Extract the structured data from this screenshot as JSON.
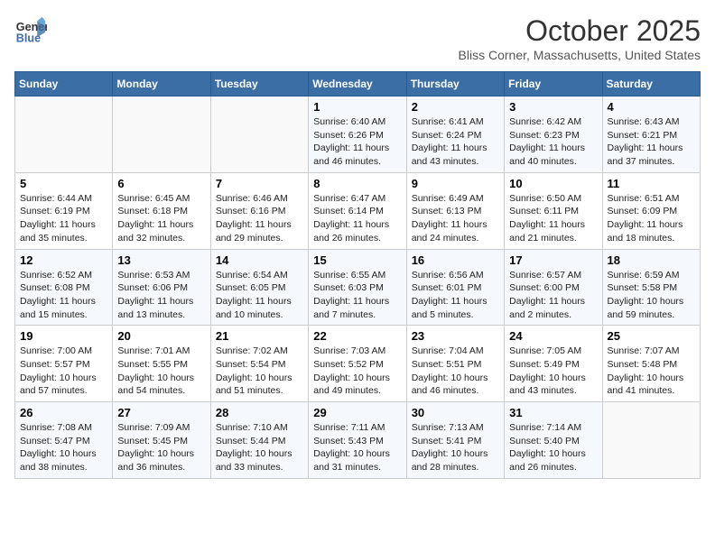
{
  "header": {
    "logo_line1": "General",
    "logo_line2": "Blue",
    "month": "October 2025",
    "location": "Bliss Corner, Massachusetts, United States"
  },
  "days_of_week": [
    "Sunday",
    "Monday",
    "Tuesday",
    "Wednesday",
    "Thursday",
    "Friday",
    "Saturday"
  ],
  "weeks": [
    [
      {
        "num": "",
        "info": ""
      },
      {
        "num": "",
        "info": ""
      },
      {
        "num": "",
        "info": ""
      },
      {
        "num": "1",
        "info": "Sunrise: 6:40 AM\nSunset: 6:26 PM\nDaylight: 11 hours and 46 minutes."
      },
      {
        "num": "2",
        "info": "Sunrise: 6:41 AM\nSunset: 6:24 PM\nDaylight: 11 hours and 43 minutes."
      },
      {
        "num": "3",
        "info": "Sunrise: 6:42 AM\nSunset: 6:23 PM\nDaylight: 11 hours and 40 minutes."
      },
      {
        "num": "4",
        "info": "Sunrise: 6:43 AM\nSunset: 6:21 PM\nDaylight: 11 hours and 37 minutes."
      }
    ],
    [
      {
        "num": "5",
        "info": "Sunrise: 6:44 AM\nSunset: 6:19 PM\nDaylight: 11 hours and 35 minutes."
      },
      {
        "num": "6",
        "info": "Sunrise: 6:45 AM\nSunset: 6:18 PM\nDaylight: 11 hours and 32 minutes."
      },
      {
        "num": "7",
        "info": "Sunrise: 6:46 AM\nSunset: 6:16 PM\nDaylight: 11 hours and 29 minutes."
      },
      {
        "num": "8",
        "info": "Sunrise: 6:47 AM\nSunset: 6:14 PM\nDaylight: 11 hours and 26 minutes."
      },
      {
        "num": "9",
        "info": "Sunrise: 6:49 AM\nSunset: 6:13 PM\nDaylight: 11 hours and 24 minutes."
      },
      {
        "num": "10",
        "info": "Sunrise: 6:50 AM\nSunset: 6:11 PM\nDaylight: 11 hours and 21 minutes."
      },
      {
        "num": "11",
        "info": "Sunrise: 6:51 AM\nSunset: 6:09 PM\nDaylight: 11 hours and 18 minutes."
      }
    ],
    [
      {
        "num": "12",
        "info": "Sunrise: 6:52 AM\nSunset: 6:08 PM\nDaylight: 11 hours and 15 minutes."
      },
      {
        "num": "13",
        "info": "Sunrise: 6:53 AM\nSunset: 6:06 PM\nDaylight: 11 hours and 13 minutes."
      },
      {
        "num": "14",
        "info": "Sunrise: 6:54 AM\nSunset: 6:05 PM\nDaylight: 11 hours and 10 minutes."
      },
      {
        "num": "15",
        "info": "Sunrise: 6:55 AM\nSunset: 6:03 PM\nDaylight: 11 hours and 7 minutes."
      },
      {
        "num": "16",
        "info": "Sunrise: 6:56 AM\nSunset: 6:01 PM\nDaylight: 11 hours and 5 minutes."
      },
      {
        "num": "17",
        "info": "Sunrise: 6:57 AM\nSunset: 6:00 PM\nDaylight: 11 hours and 2 minutes."
      },
      {
        "num": "18",
        "info": "Sunrise: 6:59 AM\nSunset: 5:58 PM\nDaylight: 10 hours and 59 minutes."
      }
    ],
    [
      {
        "num": "19",
        "info": "Sunrise: 7:00 AM\nSunset: 5:57 PM\nDaylight: 10 hours and 57 minutes."
      },
      {
        "num": "20",
        "info": "Sunrise: 7:01 AM\nSunset: 5:55 PM\nDaylight: 10 hours and 54 minutes."
      },
      {
        "num": "21",
        "info": "Sunrise: 7:02 AM\nSunset: 5:54 PM\nDaylight: 10 hours and 51 minutes."
      },
      {
        "num": "22",
        "info": "Sunrise: 7:03 AM\nSunset: 5:52 PM\nDaylight: 10 hours and 49 minutes."
      },
      {
        "num": "23",
        "info": "Sunrise: 7:04 AM\nSunset: 5:51 PM\nDaylight: 10 hours and 46 minutes."
      },
      {
        "num": "24",
        "info": "Sunrise: 7:05 AM\nSunset: 5:49 PM\nDaylight: 10 hours and 43 minutes."
      },
      {
        "num": "25",
        "info": "Sunrise: 7:07 AM\nSunset: 5:48 PM\nDaylight: 10 hours and 41 minutes."
      }
    ],
    [
      {
        "num": "26",
        "info": "Sunrise: 7:08 AM\nSunset: 5:47 PM\nDaylight: 10 hours and 38 minutes."
      },
      {
        "num": "27",
        "info": "Sunrise: 7:09 AM\nSunset: 5:45 PM\nDaylight: 10 hours and 36 minutes."
      },
      {
        "num": "28",
        "info": "Sunrise: 7:10 AM\nSunset: 5:44 PM\nDaylight: 10 hours and 33 minutes."
      },
      {
        "num": "29",
        "info": "Sunrise: 7:11 AM\nSunset: 5:43 PM\nDaylight: 10 hours and 31 minutes."
      },
      {
        "num": "30",
        "info": "Sunrise: 7:13 AM\nSunset: 5:41 PM\nDaylight: 10 hours and 28 minutes."
      },
      {
        "num": "31",
        "info": "Sunrise: 7:14 AM\nSunset: 5:40 PM\nDaylight: 10 hours and 26 minutes."
      },
      {
        "num": "",
        "info": ""
      }
    ]
  ]
}
